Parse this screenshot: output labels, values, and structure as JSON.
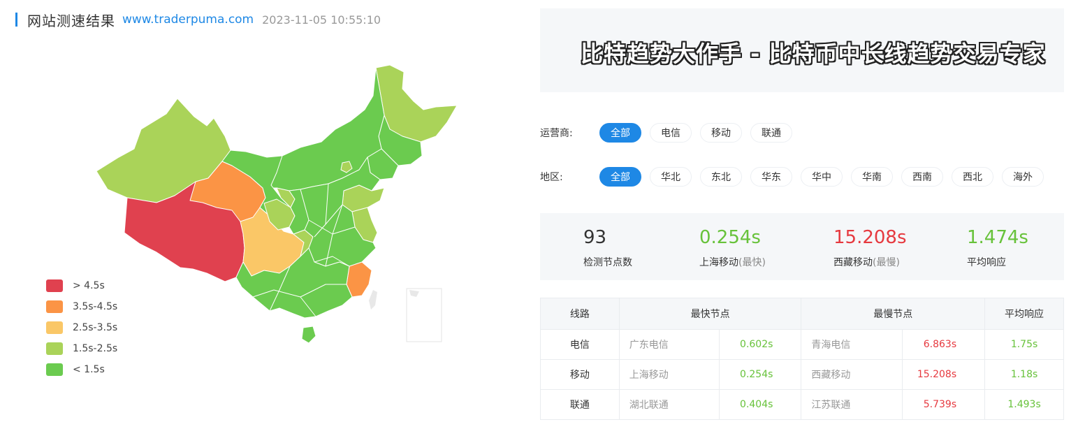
{
  "header": {
    "title": "网站测速结果",
    "url": "www.traderpuma.com",
    "time": "2023-11-05 10:55:10"
  },
  "banner": {
    "text": "比特趋势大作手 - 比特币中长线趋势交易专家"
  },
  "filters": {
    "carrier_label": "运营商:",
    "carriers": [
      "全部",
      "电信",
      "移动",
      "联通"
    ],
    "carrier_selected": "全部",
    "region_label": "地区:",
    "regions": [
      "全部",
      "华北",
      "东北",
      "华东",
      "华中",
      "华南",
      "西南",
      "西北",
      "海外"
    ],
    "region_selected": "全部"
  },
  "stats": {
    "count": {
      "value": "93",
      "label": "检测节点数"
    },
    "fastest": {
      "value": "0.254s",
      "label": "上海移动",
      "sub": "(最快)"
    },
    "slowest": {
      "value": "15.208s",
      "label": "西藏移动",
      "sub": "(最慢)"
    },
    "average": {
      "value": "1.474s",
      "label": "平均响应"
    }
  },
  "table": {
    "headers": [
      "线路",
      "最快节点",
      "最慢节点",
      "平均响应"
    ],
    "rows": [
      {
        "line": "电信",
        "fast_node": "广东电信",
        "fast_time": "0.602s",
        "slow_node": "青海电信",
        "slow_time": "6.863s",
        "avg": "1.75s"
      },
      {
        "line": "移动",
        "fast_node": "上海移动",
        "fast_time": "0.254s",
        "slow_node": "西藏移动",
        "slow_time": "15.208s",
        "avg": "1.18s"
      },
      {
        "line": "联通",
        "fast_node": "湖北联通",
        "fast_time": "0.404s",
        "slow_node": "江苏联通",
        "slow_time": "5.739s",
        "avg": "1.493s"
      }
    ]
  },
  "legend": [
    {
      "label": "> 4.5s",
      "color": "#e0414f"
    },
    {
      "label": "3.5s-4.5s",
      "color": "#fb9445"
    },
    {
      "label": "2.5s-3.5s",
      "color": "#fac767"
    },
    {
      "label": "1.5s-2.5s",
      "color": "#aad359"
    },
    {
      "label": "< 1.5s",
      "color": "#6bcb4f"
    }
  ],
  "colors": {
    "accent": "#1e88e5",
    "fast": "#67c23a",
    "slow": "#e6393f",
    "panel_bg": "#f5f7f9"
  },
  "map": {
    "regions": [
      {
        "name": "xinjiang",
        "tier": 3
      },
      {
        "name": "xizang",
        "tier": 0
      },
      {
        "name": "qinghai",
        "tier": 1
      },
      {
        "name": "sichuan",
        "tier": 2
      },
      {
        "name": "fujian",
        "tier": 1
      },
      {
        "name": "heilongjiang",
        "tier": 3
      },
      {
        "name": "jilin",
        "tier": 4
      },
      {
        "name": "liaoning",
        "tier": 4
      },
      {
        "name": "neimenggu",
        "tier": 4
      },
      {
        "name": "gansu",
        "tier": 4
      },
      {
        "name": "ningxia",
        "tier": 3
      },
      {
        "name": "shanxi",
        "tier": 3
      },
      {
        "name": "shandong",
        "tier": 3
      },
      {
        "name": "jiangsu",
        "tier": 3
      },
      {
        "name": "chongqing",
        "tier": 3
      },
      {
        "name": "tianjin",
        "tier": 3
      },
      {
        "name": "central-east",
        "tier": 4
      },
      {
        "name": "south",
        "tier": 4
      },
      {
        "name": "hainan",
        "tier": 4
      }
    ]
  }
}
